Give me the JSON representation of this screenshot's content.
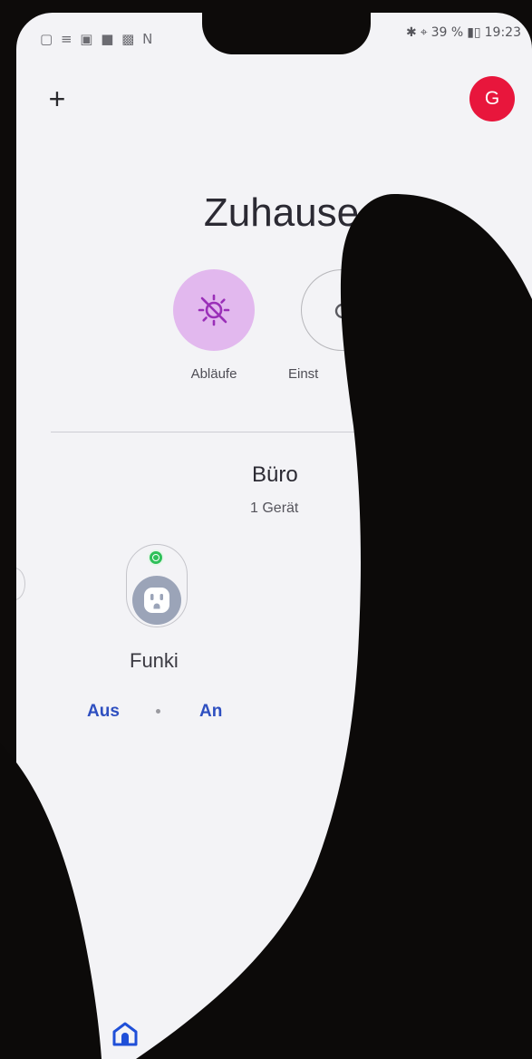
{
  "status_bar": {
    "left_icons": "▢ ≡ ▣ ■ ▩ N",
    "battery": "39 %",
    "time": "19:23"
  },
  "header": {
    "add_glyph": "+",
    "avatar_initial": "G"
  },
  "home": {
    "title": "Zuhause"
  },
  "chips": {
    "routines_label": "Abläufe",
    "settings_label": "Einst"
  },
  "room": {
    "name": "Büro",
    "device_count": "1 Gerät"
  },
  "device": {
    "name": "Funki",
    "status": "online",
    "off_label": "Aus",
    "on_label": "An"
  },
  "colors": {
    "avatar": "#e8163c",
    "routines_chip": "#e2b8ee",
    "routines_icon": "#9a2fb8",
    "status_online": "#2fc05a",
    "action_text": "#2e4fc0",
    "home_icon": "#1f4fd8"
  },
  "icons": {
    "add": "plus-icon",
    "routines": "routines-sun-off-icon",
    "settings": "settings-gear-icon",
    "device": "smart-plug-icon",
    "nav": "home-icon"
  }
}
